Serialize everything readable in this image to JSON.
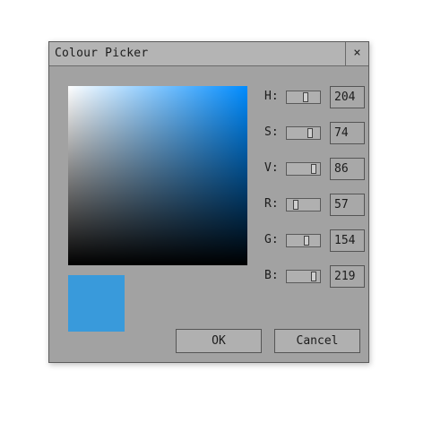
{
  "dialog": {
    "title": "Colour Picker",
    "close_label": "×"
  },
  "colors": {
    "hue_color": "#008cff",
    "current_color": "#399adb",
    "dialog_bg": "#a2a2a2"
  },
  "channels": [
    {
      "label": "H:",
      "value": "204",
      "fraction": 0.57
    },
    {
      "label": "S:",
      "value": "74",
      "fraction": 0.74
    },
    {
      "label": "V:",
      "value": "86",
      "fraction": 0.86
    },
    {
      "label": "R:",
      "value": "57",
      "fraction": 0.22
    },
    {
      "label": "G:",
      "value": "154",
      "fraction": 0.6
    },
    {
      "label": "B:",
      "value": "219",
      "fraction": 0.86
    }
  ],
  "buttons": {
    "ok_label": "OK",
    "cancel_label": "Cancel"
  }
}
